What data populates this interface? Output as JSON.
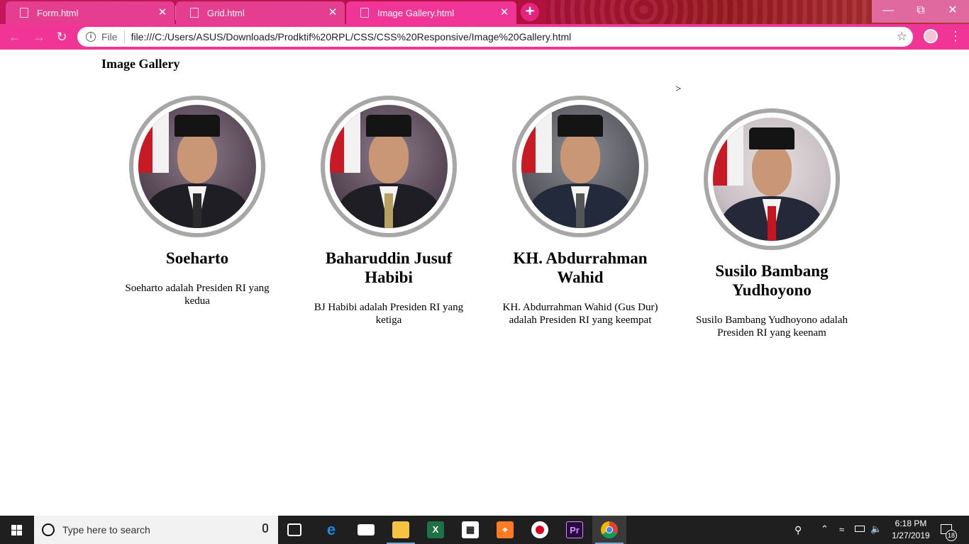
{
  "browser": {
    "tabs": [
      {
        "label": "Form.html"
      },
      {
        "label": "Grid.html"
      },
      {
        "label": "Image Gallery.html"
      }
    ],
    "address": {
      "scheme": "File",
      "url": "file:///C:/Users/ASUS/Downloads/Prodktif%20RPL/CSS/CSS%20Responsive/Image%20Gallery.html"
    }
  },
  "page": {
    "title": "Image Gallery",
    "stray_text": ">",
    "cards": [
      {
        "name": "Soeharto",
        "desc": "Soeharto adalah Presiden RI yang kedua"
      },
      {
        "name": "Baharuddin Jusuf Habibi",
        "desc": "BJ Habibi adalah Presiden RI yang ketiga"
      },
      {
        "name": "KH. Abdurrahman Wahid",
        "desc": "KH. Abdurrahman Wahid (Gus Dur) adalah Presiden RI yang keempat"
      },
      {
        "name": "Susilo Bambang Yudhoyono",
        "desc": "Susilo Bambang Yudhoyono adalah Presiden RI yang keenam"
      }
    ]
  },
  "taskbar": {
    "search_placeholder": "Type here to search",
    "time": "6:18 PM",
    "date": "1/27/2019",
    "notification_count": "18",
    "apps": [
      "task-view",
      "edge",
      "mail",
      "file-explorer",
      "excel",
      "store",
      "xampp",
      "recorder",
      "premiere",
      "chrome"
    ]
  }
}
